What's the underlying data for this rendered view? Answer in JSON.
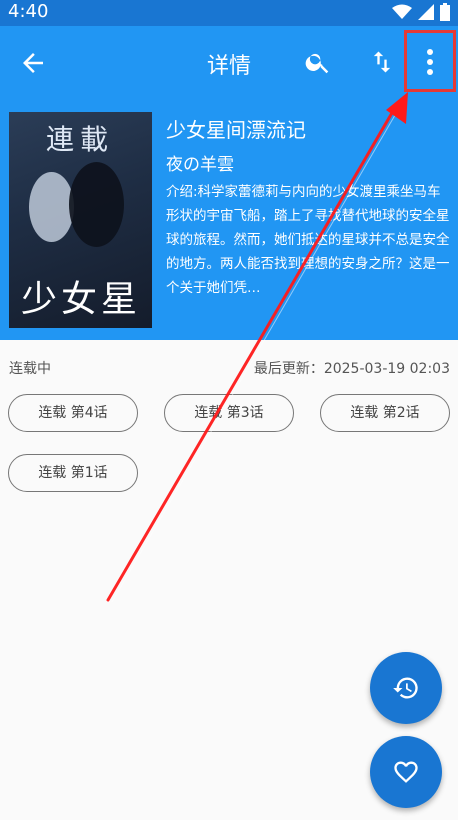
{
  "status_bar": {
    "time": "4:40"
  },
  "app_bar": {
    "title": "详情"
  },
  "comic": {
    "title": "少女星间漂流记",
    "author": "夜の羊雲",
    "description": "介绍:科学家蕾德莉与内向的少女渡里乘坐马车形状的宇宙飞船，踏上了寻找替代地球的安全星球的旅程。然而，她们抵达的星球并不总是安全的地方。两人能否找到理想的安身之所？这是一个关于她们凭…",
    "cover_top_text": "連載",
    "cover_bottom_text": "少女星"
  },
  "info": {
    "status": "连载中",
    "last_update": "最后更新：2025-03-19 02:03"
  },
  "chapters": [
    {
      "label": "连载 第4话"
    },
    {
      "label": "连载 第3话"
    },
    {
      "label": "连载 第2话"
    },
    {
      "label": "连载 第1话"
    }
  ],
  "colors": {
    "primary": "#2196f3",
    "primary_dark": "#1976d2",
    "highlight": "#e53935"
  },
  "icons": [
    "back-icon",
    "search-icon",
    "sort-icon",
    "more-vert-icon",
    "history-icon",
    "heart-icon",
    "wifi-icon",
    "signal-icon",
    "battery-icon"
  ]
}
